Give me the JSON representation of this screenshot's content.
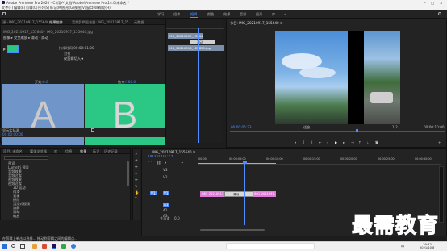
{
  "title_bar": {
    "title": "Adobe Premiere Pro 2020 - C:\\用户\\文档\\Adobe\\Premiere Pro\\14.0\\未命名 *"
  },
  "menu": [
    "文件(F)",
    "编辑(E)",
    "剪辑(C)",
    "序列(S)",
    "标记(M)",
    "图形(G)",
    "视图(V)",
    "窗口(W)",
    "帮助(H)"
  ],
  "workspaces": {
    "items": [
      "学习",
      "组件",
      "编辑",
      "颜色",
      "效果",
      "音频",
      "图形",
      "库"
    ],
    "active": "编辑"
  },
  "source_panel": {
    "tabs": [
      "效果控件",
      "音频剪辑混合器: IMG_20210917_155640",
      "元数据"
    ],
    "active_tab": "效果控件",
    "header_left": "源 · IMG_20210917_155640.jpg",
    "header_right": "IMG_20210917_155640 · IMG_20210917_155640.jpg",
    "sub": "图像 ▸ 交叉缩放 ▸ 滑动 · 滑动",
    "transition_row": "持续时间 00:00:01:00",
    "row2": "对齐",
    "row3": "仅剪辑切入 ▾",
    "label_a": "开始:",
    "label_a_value": "0.0",
    "label_b": "结束:",
    "label_b_value": "100.0",
    "letter_a": "A",
    "letter_b": "B",
    "show_actual": "显示实际源",
    "timecode": "00:00:00:00"
  },
  "mini_timeline": {
    "clip1": "IMG_20210917_155640.jpg",
    "clip2": "IMG_20210918_125850.jpg",
    "transition": "滑动"
  },
  "program_monitor": {
    "title": "节目: IMG_20210917_155640 ≡",
    "timecode_left": "00:00:05:23",
    "fit": "适合",
    "fraction": "1/2",
    "timecode_right": "00:00:10:00"
  },
  "project_panel": {
    "tabs": [
      "项目: 未命名",
      "媒体浏览器",
      "库",
      "信息",
      "效果",
      "标记",
      "历史记录"
    ],
    "active_tab": "效果",
    "items": [
      {
        "label": "预设",
        "level": 0
      },
      {
        "label": "Lumetri 预设",
        "level": 0
      },
      {
        "label": "音频效果",
        "level": 0
      },
      {
        "label": "音频过渡",
        "level": 0
      },
      {
        "label": "视频效果",
        "level": 0
      },
      {
        "label": "视频过渡",
        "level": 0
      },
      {
        "label": "3D 运动",
        "level": 1
      },
      {
        "label": "内滑",
        "level": 1
      },
      {
        "label": "划像",
        "level": 1
      },
      {
        "label": "擦除",
        "level": 1
      },
      {
        "label": "沉浸式视频",
        "level": 1
      },
      {
        "label": "溶解",
        "level": 1
      },
      {
        "label": "滑动",
        "level": 1
      },
      {
        "label": "缩放",
        "level": 1
      },
      {
        "label": "交叉缩放",
        "level": 2
      },
      {
        "label": "页面剥落",
        "level": 1
      }
    ],
    "status": "在剪辑上单击以选择... 拖动到剪辑之间的编辑点..."
  },
  "timeline": {
    "tab": "IMG_20210917_155640 ≡",
    "timecode": "00:00:05:23",
    "ruler": [
      "00:00",
      "00:00:05:00",
      "00:00:10:00",
      "00:00:15:00",
      "00:00:20:00",
      "00:00:25:00",
      "00:00:30:00"
    ],
    "tracks_video": [
      "V3",
      "V2",
      "V1"
    ],
    "tracks_audio": [
      "A1",
      "A2",
      "A3"
    ],
    "master": "主声道",
    "master_value": "0.0",
    "clip1": "IMG_20210917_...",
    "clip2": "IMG_2021091...",
    "transition": "滑动"
  },
  "taskbar": {
    "time": "19:42",
    "date": "2021/10/8",
    "lang": "中"
  },
  "watermark": "最需教育",
  "colors": {
    "accent": "#4f8dff",
    "clip": "#e07ad8",
    "slide_a": "#6f95c9",
    "slide_b": "#2bc785",
    "sky": "#5b9bdc"
  }
}
